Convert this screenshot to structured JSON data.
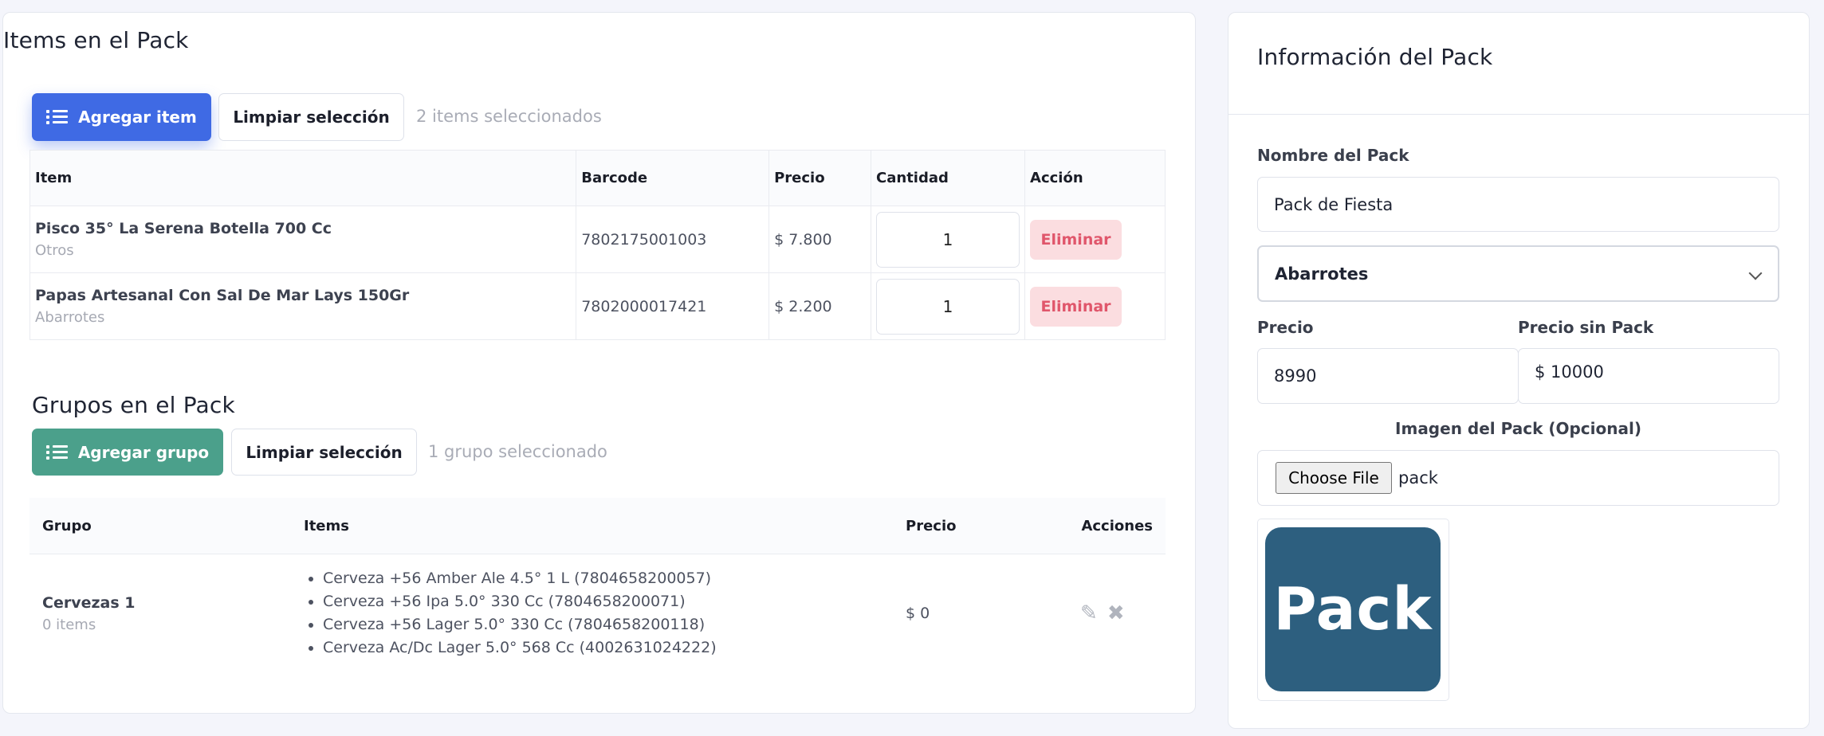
{
  "items_section": {
    "title": "Items en el Pack",
    "add_button": "Agregar item",
    "clear_button": "Limpiar selección",
    "selected_text": "2 items seleccionados",
    "columns": [
      "Item",
      "Barcode",
      "Precio",
      "Cantidad",
      "Acción"
    ],
    "rows": [
      {
        "name": "Pisco 35° La Serena Botella 700 Cc",
        "category": "Otros",
        "barcode": "7802175001003",
        "price": "$ 7.800",
        "quantity": "1",
        "action": "Eliminar"
      },
      {
        "name": "Papas Artesanal Con Sal De Mar Lays 150Gr",
        "category": "Abarrotes",
        "barcode": "7802000017421",
        "price": "$ 2.200",
        "quantity": "1",
        "action": "Eliminar"
      }
    ]
  },
  "groups_section": {
    "title": "Grupos en el Pack",
    "add_button": "Agregar grupo",
    "clear_button": "Limpiar selección",
    "selected_text": "1 grupo seleccionado",
    "columns": [
      "Grupo",
      "Items",
      "Precio",
      "Acciones"
    ],
    "rows": [
      {
        "name": "Cervezas 1",
        "count": "0 items",
        "items": [
          "Cerveza +56 Amber Ale 4.5° 1 L (7804658200057)",
          "Cerveza +56 Ipa 5.0° 330 Cc (7804658200071)",
          "Cerveza +56 Lager 5.0° 330 Cc (7804658200118)",
          "Cerveza Ac/Dc Lager 5.0° 568 Cc (4002631024222)"
        ],
        "price": "$ 0",
        "edit_icon": "edit-icon",
        "delete_icon": "close-icon"
      }
    ]
  },
  "pack_info": {
    "title": "Información del Pack",
    "name_label": "Nombre del Pack",
    "name_value": "Pack de Fiesta",
    "category_value": "Abarrotes",
    "price_label": "Precio",
    "price_value": "8990",
    "price_without_label": "Precio sin Pack",
    "price_without_value": "$ 10000",
    "image_label": "Imagen del Pack (Opcional)",
    "file_button": "Choose File",
    "file_name": "pack",
    "image_text": "Pack"
  },
  "colors": {
    "primary": "#3f6ae4",
    "success": "#4ba08b",
    "danger_bg": "#fbdde0",
    "danger_text": "#e0566b",
    "pack_image": "#2d5f7f"
  }
}
